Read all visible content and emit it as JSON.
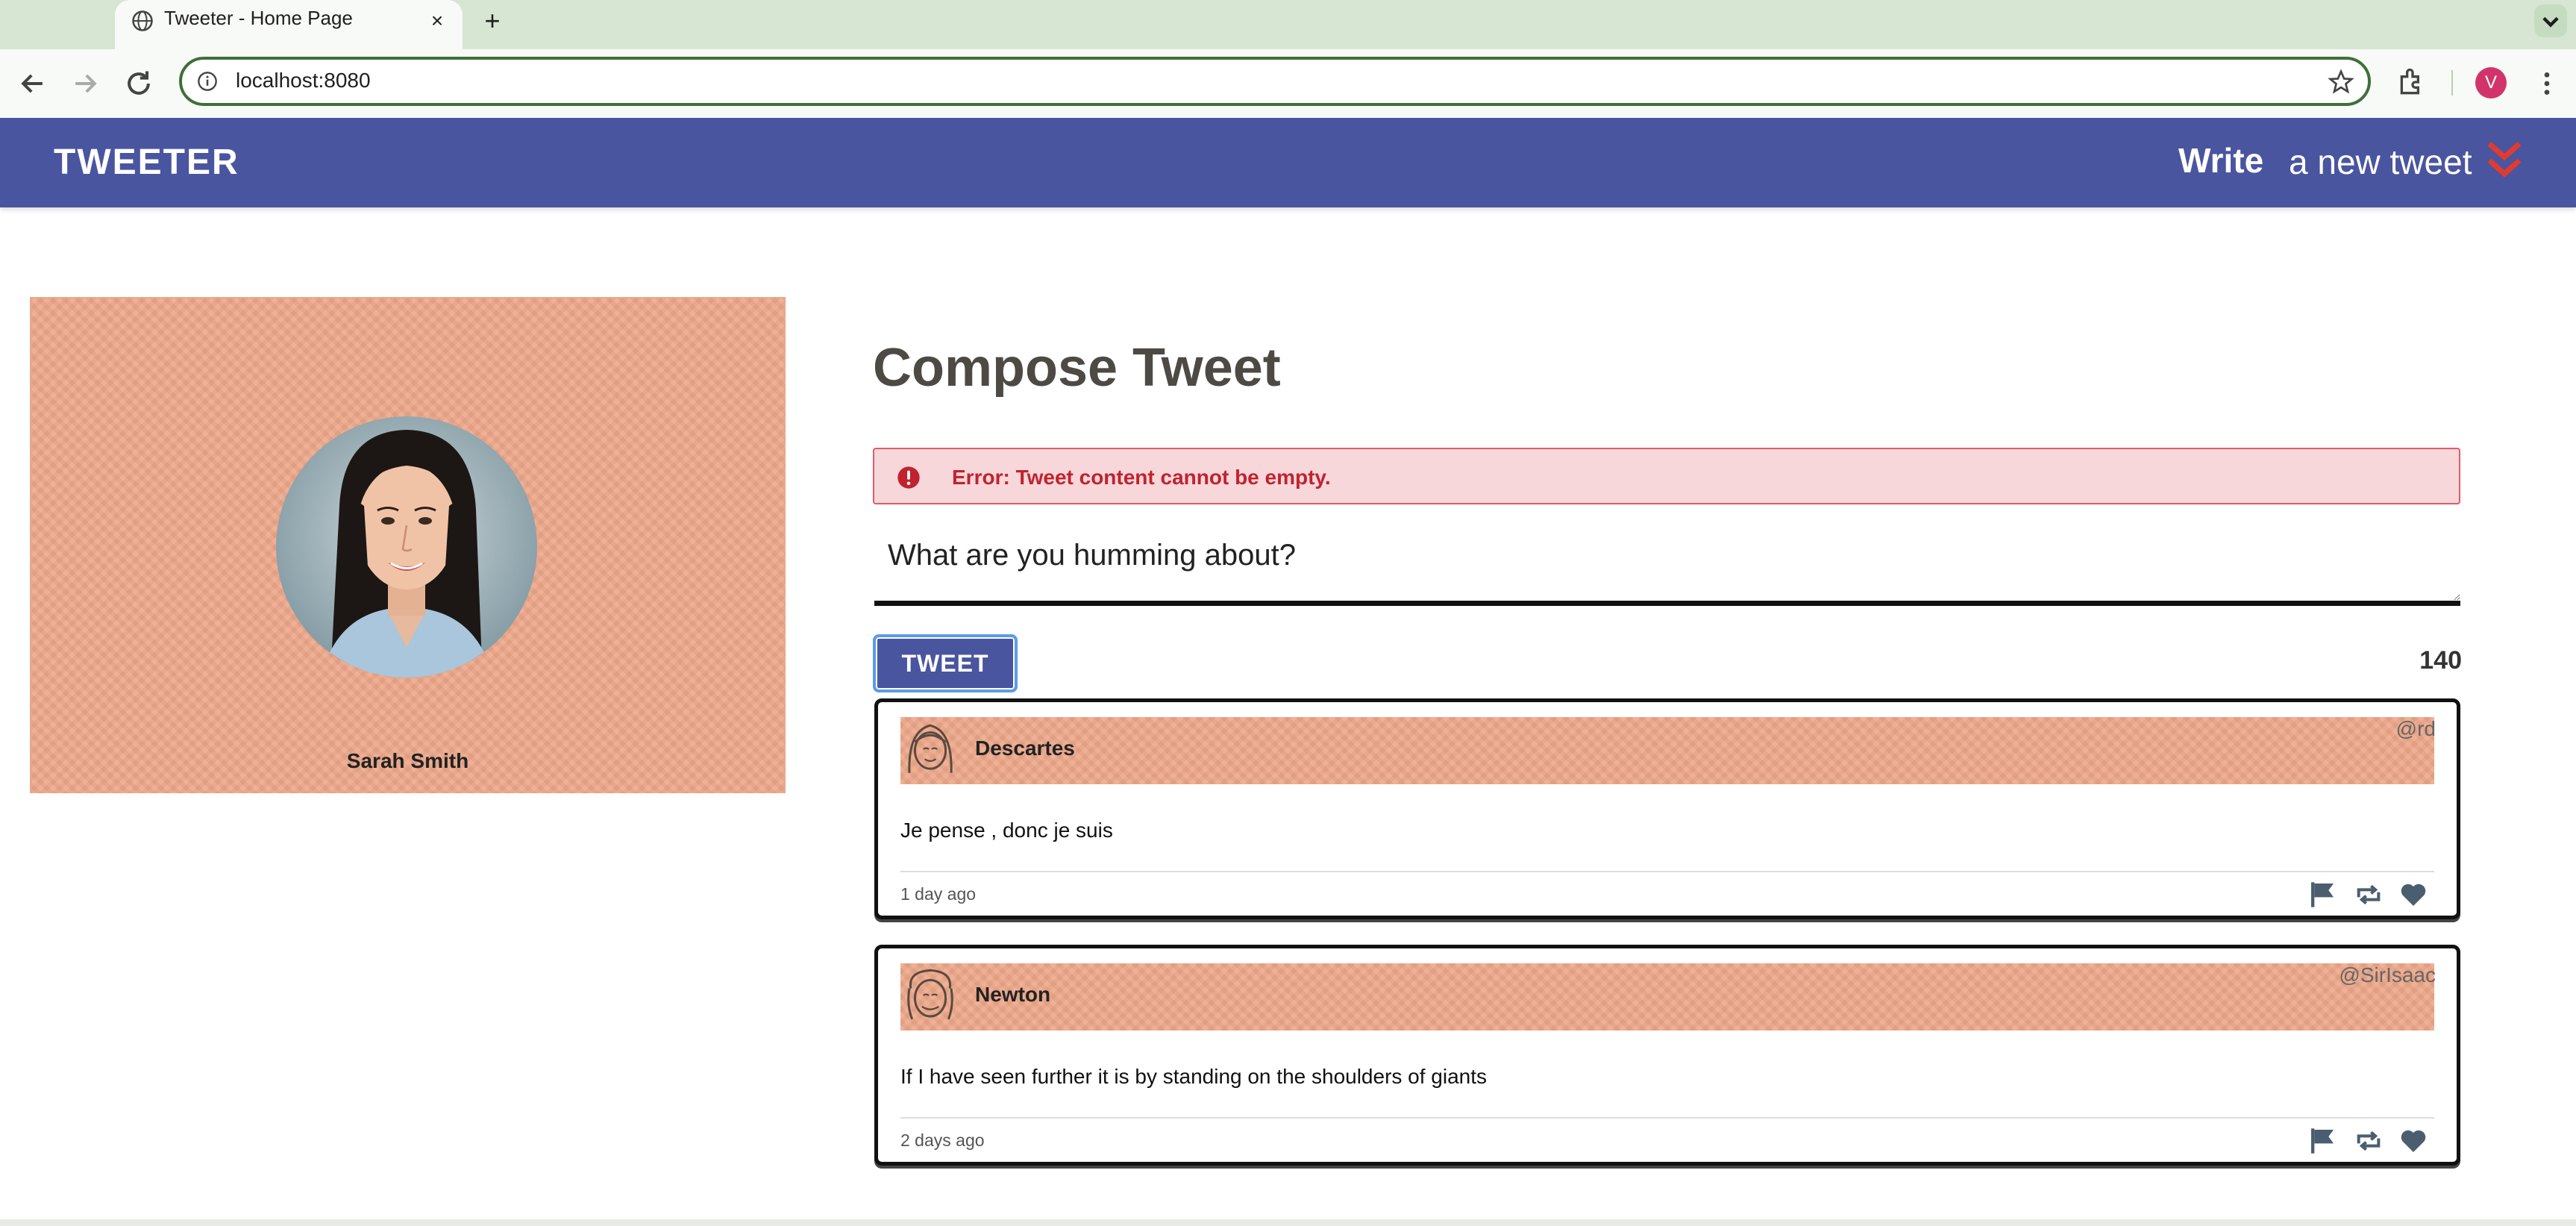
{
  "browser": {
    "tab_title": "Tweeter - Home Page",
    "new_tab_symbol": "+",
    "close_symbol": "×",
    "url": "localhost:8080",
    "profile_initial": "V",
    "icons": [
      "globe-icon",
      "close-icon",
      "plus-icon",
      "chevron-down-icon",
      "back-icon",
      "forward-icon",
      "reload-icon",
      "site-info-icon",
      "star-icon",
      "extensions-icon",
      "kebab-menu-icon"
    ]
  },
  "nav": {
    "brand": "TWEETER",
    "write_bold": "Write",
    "write_rest": "a new tweet",
    "accent_color": "#e23b2e",
    "bar_color": "#4a55a0"
  },
  "profile": {
    "name": "Sarah Smith",
    "card_color": "#eea88a"
  },
  "compose": {
    "title": "Compose Tweet",
    "error": "Error: Tweet content cannot be empty.",
    "placeholder": "What are you humming about?",
    "button_label": "TWEET",
    "counter": "140"
  },
  "tweets": [
    {
      "name": "Descartes",
      "handle": "@rd",
      "text": "Je pense , donc je suis",
      "time": "1 day ago"
    },
    {
      "name": "Newton",
      "handle": "@SirIsaac",
      "text": "If I have seen further it is by standing on the shoulders of giants",
      "time": "2 days ago"
    }
  ]
}
